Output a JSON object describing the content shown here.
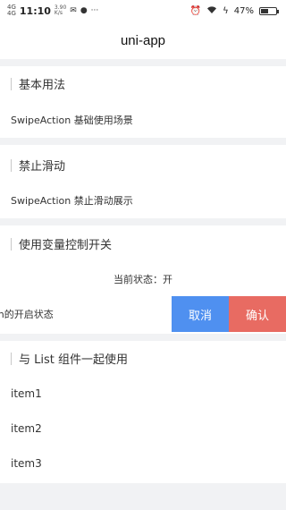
{
  "status_bar": {
    "signal": "4G",
    "signal2": "4G",
    "time": "11:10",
    "speed": "3.90",
    "speed_unit": "K/s",
    "more": "···",
    "battery": "47%",
    "battery_level": 0.47
  },
  "nav": {
    "title": "uni-app"
  },
  "sections": [
    {
      "title": "基本用法",
      "row": "SwipeAction 基础使用场景"
    },
    {
      "title": "禁止滑动",
      "row": "SwipeAction 禁止滑动展示"
    },
    {
      "title": "使用变量控制开关",
      "status": "当前状态：开",
      "row": "ion的开启状态",
      "actions": [
        "取消",
        "确认"
      ]
    },
    {
      "title": "与 List 组件一起使用",
      "items": [
        "item1",
        "item2",
        "item3"
      ]
    }
  ]
}
